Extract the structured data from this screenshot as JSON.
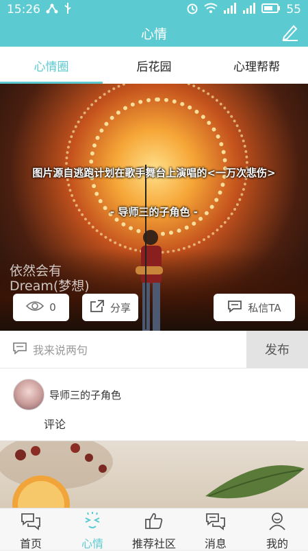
{
  "status": {
    "time": "15:26",
    "battery": "55"
  },
  "header": {
    "title": "心情"
  },
  "tabs": [
    {
      "label": "心情圈",
      "active": true
    },
    {
      "label": "后花园",
      "active": false
    },
    {
      "label": "心理帮帮",
      "active": false
    }
  ],
  "post": {
    "caption": "图片源自逃跑计划在歌手舞台上演唱的<一万次悲伤>",
    "author_caption": "- 导师三的子角色 -",
    "watermark_line1": "依然会有",
    "watermark_line2": "Dream(梦想)",
    "views": "0",
    "share_label": "分享",
    "message_label": "私信TA"
  },
  "comment": {
    "placeholder": "我来说两句",
    "publish_label": "发布"
  },
  "comment_item": {
    "username": "导师三的子角色",
    "text": "评论"
  },
  "nav": [
    {
      "label": "首页",
      "icon": "chat-bubbles-icon"
    },
    {
      "label": "心情",
      "icon": "mood-icon"
    },
    {
      "label": "推荐社区",
      "icon": "thumbs-up-icon"
    },
    {
      "label": "消息",
      "icon": "message-icon"
    },
    {
      "label": "我的",
      "icon": "person-icon"
    }
  ],
  "colors": {
    "accent": "#5ccbd1"
  }
}
